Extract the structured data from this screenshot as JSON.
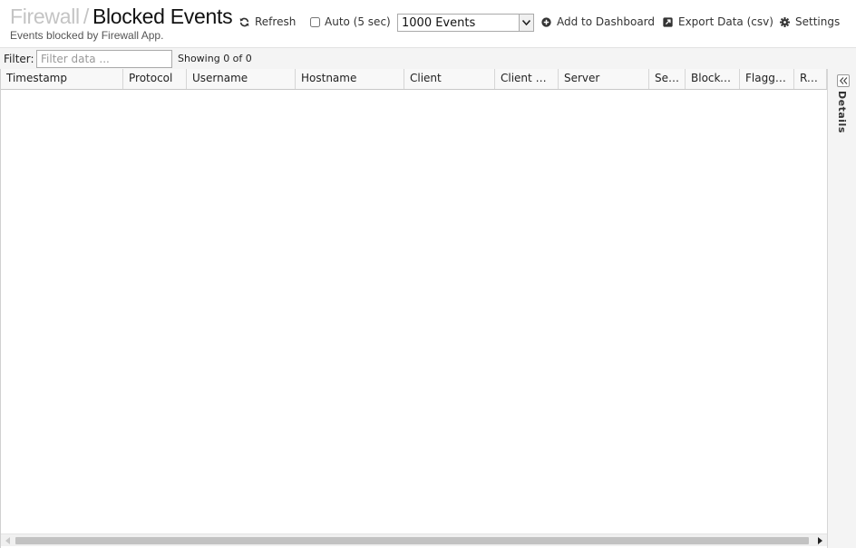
{
  "header": {
    "breadcrumb_parent": "Firewall",
    "breadcrumb_separator": "/",
    "title": "Blocked Events",
    "subtitle": "Events blocked by Firewall App."
  },
  "toolbar": {
    "refresh_label": "Refresh",
    "auto_label": "Auto (5 sec)",
    "auto_checked": false,
    "events_select_value": "1000 Events",
    "add_dashboard_label": "Add to Dashboard",
    "export_label": "Export Data (csv)",
    "settings_label": "Settings"
  },
  "filter": {
    "label": "Filter:",
    "placeholder": "Filter data ...",
    "value": "",
    "showing_text": "Showing 0 of 0"
  },
  "grid": {
    "columns": [
      "Timestamp",
      "Protocol",
      "Username",
      "Hostname",
      "Client",
      "Client Port",
      "Server",
      "Server Port",
      "Blocked",
      "Flagged",
      "Rule"
    ],
    "rows": []
  },
  "details_panel": {
    "label": "Details"
  },
  "icons": {
    "refresh": "refresh-icon",
    "add": "plus-circle-icon",
    "export": "export-icon",
    "settings": "gear-icon",
    "dropdown": "chevron-down-icon",
    "collapse": "double-chevron-left-icon"
  }
}
